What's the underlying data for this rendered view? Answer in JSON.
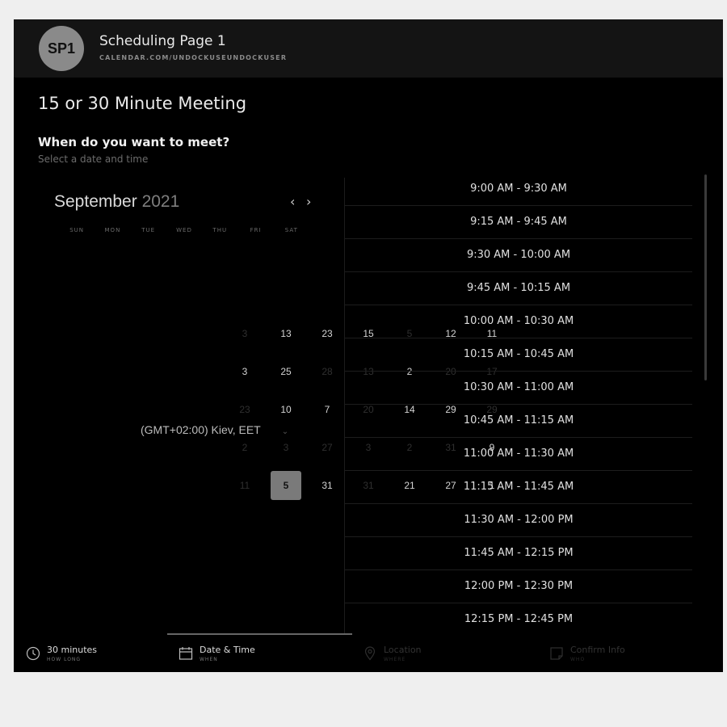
{
  "header": {
    "avatar_initials": "SP1",
    "page_name": "Scheduling Page 1",
    "page_url": "CALENDAR.COM/UNDOCKUSEUNDOCKUSER"
  },
  "event": {
    "title": "15 or 30 Minute Meeting",
    "question": "When do you want to meet?",
    "hint": "Select a date and time"
  },
  "calendar": {
    "month": "September",
    "year": "2021",
    "prev_icon": "‹",
    "next_icon": "›",
    "weekdays": [
      "SUN",
      "MON",
      "TUE",
      "WED",
      "THU",
      "FRI",
      "SAT"
    ],
    "selected_day": "5",
    "days": [
      {
        "label": "3",
        "dim": true
      },
      {
        "label": "13"
      },
      {
        "label": "23"
      },
      {
        "label": "15"
      },
      {
        "label": "5",
        "dim": true
      },
      {
        "label": "12"
      },
      {
        "label": "11"
      },
      {
        "label": "3"
      },
      {
        "label": "25"
      },
      {
        "label": "28",
        "dim": true
      },
      {
        "label": "13",
        "dim": true
      },
      {
        "label": "2"
      },
      {
        "label": "20",
        "dim": true
      },
      {
        "label": "17",
        "dim": true
      },
      {
        "label": "23",
        "dim": true
      },
      {
        "label": "10"
      },
      {
        "label": "7"
      },
      {
        "label": "20",
        "dim": true
      },
      {
        "label": "14"
      },
      {
        "label": "29"
      },
      {
        "label": "29",
        "dim": true
      },
      {
        "label": "2",
        "dim": true
      },
      {
        "label": "3",
        "dim": true
      },
      {
        "label": "27",
        "dim": true
      },
      {
        "label": "3",
        "dim": true
      },
      {
        "label": "2",
        "dim": true
      },
      {
        "label": "31",
        "dim": true
      },
      {
        "label": "9"
      },
      {
        "label": "11",
        "dim": true
      },
      {
        "label": "5",
        "selected": true
      },
      {
        "label": "31"
      },
      {
        "label": "31",
        "dim": true
      },
      {
        "label": "21"
      },
      {
        "label": "27"
      },
      {
        "label": "1"
      }
    ]
  },
  "timezone": {
    "label": "(GMT+02:00) Kiev, EET",
    "chevron": "⌄"
  },
  "time_slots": [
    "9:00 AM - 9:30 AM",
    "9:15 AM - 9:45 AM",
    "9:30 AM - 10:00 AM",
    "9:45 AM - 10:15 AM",
    "10:00 AM - 10:30 AM",
    "10:15 AM - 10:45 AM",
    "10:30 AM - 11:00 AM",
    "10:45 AM - 11:15 AM",
    "11:00 AM - 11:30 AM",
    "11:15 AM - 11:45 AM",
    "11:30 AM - 12:00 PM",
    "11:45 AM - 12:15 PM",
    "12:00 PM - 12:30 PM",
    "12:15 PM - 12:45 PM"
  ],
  "steps": [
    {
      "label": "30 minutes",
      "sub": "HOW LONG",
      "icon": "clock-icon",
      "state": "done"
    },
    {
      "label": "Date & Time",
      "sub": "WHEN",
      "icon": "calendar-icon",
      "state": "active"
    },
    {
      "label": "Location",
      "sub": "WHERE",
      "icon": "location-pin-icon",
      "state": "upcoming"
    },
    {
      "label": "Confirm Info",
      "sub": "WHO",
      "icon": "note-icon",
      "state": "upcoming"
    }
  ],
  "colors": {
    "background": "#000000",
    "header_bg": "#141414",
    "selected_day_bg": "#7a7a7a",
    "avatar_bg": "#8a8a8a"
  }
}
